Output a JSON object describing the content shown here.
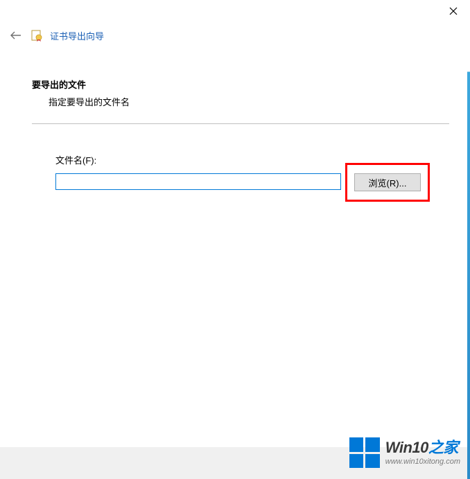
{
  "window": {
    "title": "证书导出向导"
  },
  "section": {
    "heading": "要导出的文件",
    "subtext": "指定要导出的文件名"
  },
  "field": {
    "label": "文件名(F):",
    "value": "",
    "browse_label": "浏览(R)..."
  },
  "watermark": {
    "brand_prefix": "Win10",
    "brand_suffix": "之家",
    "url": "www.win10xitong.com"
  }
}
